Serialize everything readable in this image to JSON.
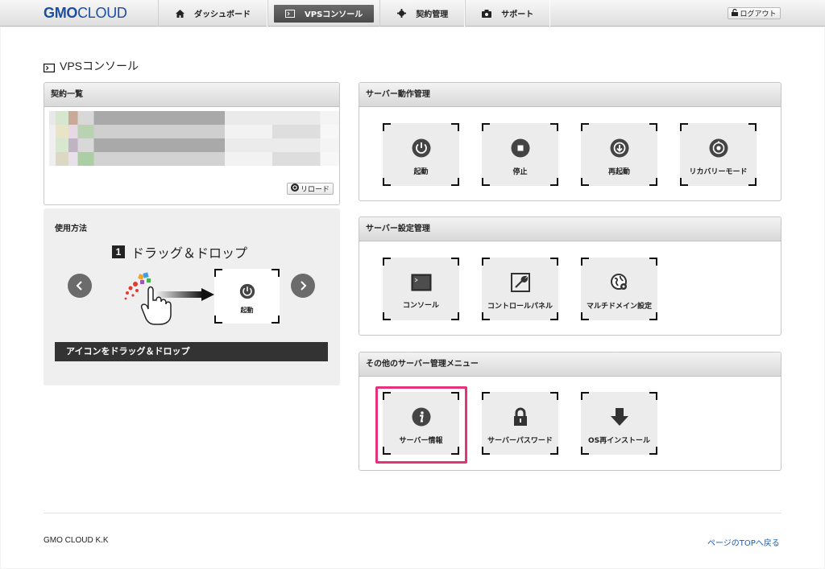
{
  "logo": {
    "brand": "GMO",
    "product": "CLOUD"
  },
  "nav": [
    {
      "label": "ダッシュボード",
      "icon": "home-icon"
    },
    {
      "label": "VPSコンソール",
      "icon": "console-icon",
      "active": true
    },
    {
      "label": "契約管理",
      "icon": "gear-icon"
    },
    {
      "label": "サポート",
      "icon": "camera-icon"
    }
  ],
  "logout_label": "ログアウト",
  "page_title": "VPSコンソール",
  "contracts": {
    "title": "契約一覧",
    "reload_label": "リロード"
  },
  "howto": {
    "title": "使用方法",
    "step_number": "1",
    "step_label": "ドラッグ＆ドロップ",
    "demo_tile_label": "起動",
    "caption": "アイコンをドラッグ＆ドロップ"
  },
  "server_ops": {
    "title": "サーバー動作管理",
    "tiles": [
      "起動",
      "停止",
      "再起動",
      "リカバリーモード"
    ]
  },
  "server_settings": {
    "title": "サーバー設定管理",
    "tiles": [
      "コンソール",
      "コントロールパネル",
      "マルチドメイン設定"
    ]
  },
  "other_menu": {
    "title": "その他のサーバー管理メニュー",
    "tiles": [
      "サーバー情報",
      "サーバーパスワード",
      "OS再インストール"
    ]
  },
  "colors": {
    "highlight": "#e5327a",
    "link": "#1a5cb3",
    "brand": "#1b4ea1"
  },
  "footer": {
    "company": "GMO CLOUD K.K",
    "back_to_top": "ページのTOPへ戻る"
  }
}
